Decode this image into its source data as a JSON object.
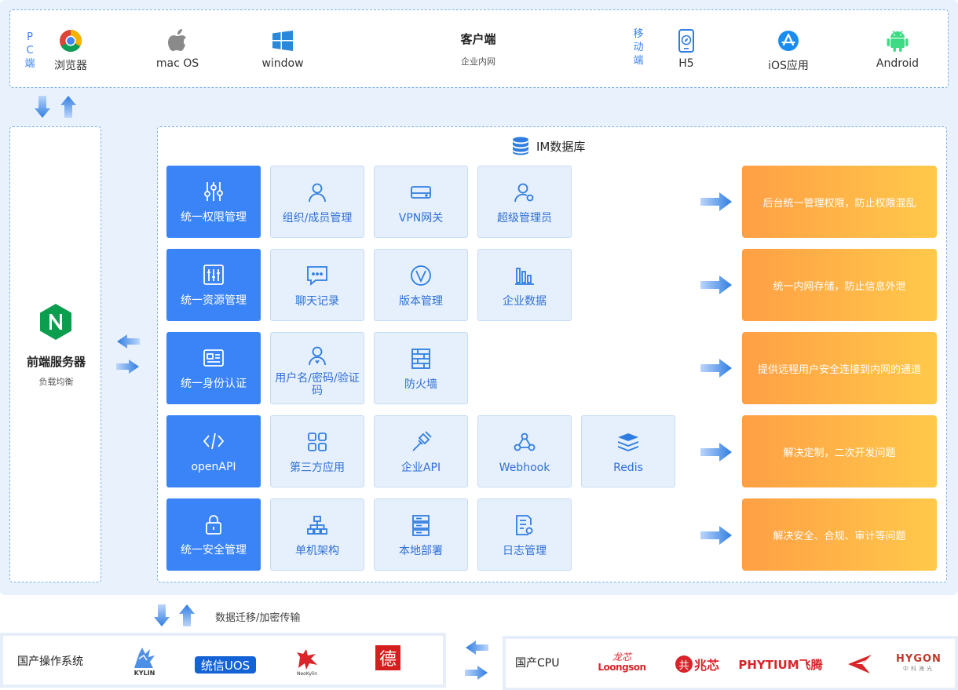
{
  "client": {
    "pc_label": [
      "P",
      "C",
      "端"
    ],
    "mobile_label": [
      "移",
      "动",
      "端"
    ],
    "title": "客户端",
    "subtitle": "企业内网",
    "items": [
      {
        "label": "浏览器",
        "icon": "chrome-icon"
      },
      {
        "label": "mac OS",
        "icon": "apple-icon"
      },
      {
        "label": "window",
        "icon": "windows-icon"
      },
      {
        "label": "H5",
        "icon": "mobile-h5-icon"
      },
      {
        "label": "iOS应用",
        "icon": "app-store-icon"
      },
      {
        "label": "Android",
        "icon": "android-icon"
      }
    ]
  },
  "frontend": {
    "title": "前端服务器",
    "subtitle": "负载均衡",
    "logo": "nginx-icon"
  },
  "im": {
    "title": "IM数据库",
    "rows": [
      {
        "main": "统一权限管理",
        "cells": [
          "组织/成员管理",
          "VPN网关",
          "超级管理员"
        ],
        "desc": "后台统一管理权限，防止权限混乱"
      },
      {
        "main": "统一资源管理",
        "cells": [
          "聊天记录",
          "版本管理",
          "企业数据"
        ],
        "desc": "统一内网存储，防止信息外泄"
      },
      {
        "main": "统一身份认证",
        "cells": [
          "用户名/密码/验证码",
          "防火墙"
        ],
        "desc": "提供远程用户安全连接到内网的通道"
      },
      {
        "main": "openAPI",
        "cells": [
          "第三方应用",
          "企业API",
          "Webhook",
          "Redis"
        ],
        "desc": "解决定制，二次开发问题"
      },
      {
        "main": "统一安全管理",
        "cells": [
          "单机架构",
          "本地部署",
          "日志管理"
        ],
        "desc": "解决安全、合规、审计等问题"
      }
    ]
  },
  "migration": "数据迁移/加密传输",
  "os": {
    "title": "国产操作系统",
    "logos": [
      "KYLIN",
      "统信UOS",
      "NeoKylin",
      "德"
    ]
  },
  "cpu": {
    "title": "国产CPU",
    "logos": [
      "Loongson",
      "兆芯",
      "PHYTIUM飞腾",
      "HYGON"
    ]
  },
  "colors": {
    "accent": "#3a84f7",
    "light_cell": "#e6f0fc",
    "orange_start": "#ff9f45",
    "orange_end": "#ffc94a"
  }
}
